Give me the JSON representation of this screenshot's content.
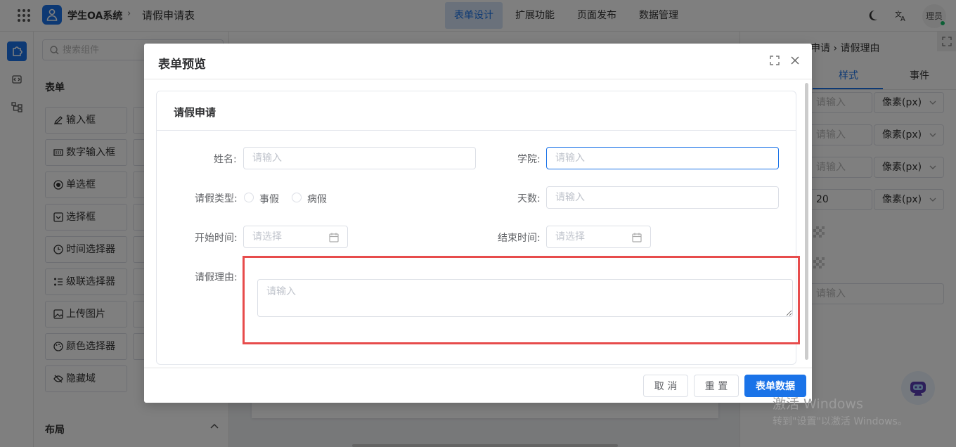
{
  "header": {
    "app_title": "学生OA系统",
    "separator": "›",
    "page_name": "请假申请表",
    "nav": [
      "表单设计",
      "扩展功能",
      "页面发布",
      "数据管理"
    ],
    "user": "理员"
  },
  "components": {
    "search_placeholder": "搜索组件",
    "section_form": "表单",
    "items": [
      "输入框",
      "数字输入框",
      "单选框",
      "选择框",
      "时间选择器",
      "级联选择器",
      "上传图片",
      "颜色选择器",
      "隐藏域"
    ],
    "section_layout": "布局"
  },
  "props": {
    "crumb": "申请 › 请假理由",
    "tabs": [
      "样式",
      "事件"
    ],
    "placeholder": "请输入",
    "unit": "像素(px)",
    "value_20": "20"
  },
  "modal": {
    "title": "表单预览",
    "card_title": "请假申请",
    "fields": {
      "name_label": "姓名:",
      "college_label": "学院:",
      "type_label": "请假类型:",
      "days_label": "天数:",
      "start_label": "开始时间:",
      "end_label": "结束时间:",
      "reason_label": "请假理由:"
    },
    "input_placeholder": "请输入",
    "date_placeholder": "请选择",
    "radio_options": [
      "事假",
      "病假"
    ],
    "buttons": {
      "cancel": "取 消",
      "reset": "重 置",
      "data": "表单数据"
    }
  },
  "watermark": {
    "line1": "激活 Windows",
    "line2": "转到\"设置\"以激活 Windows。"
  },
  "colors": {
    "primary": "#1a73e8",
    "highlight": "#e74c4c",
    "mask": "rgba(0,0,0,0.5)"
  }
}
